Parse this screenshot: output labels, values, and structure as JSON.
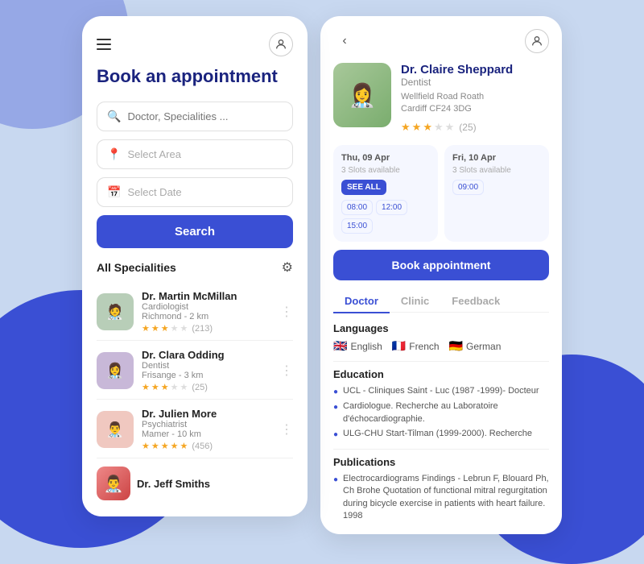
{
  "background": {
    "color": "#c8d8f0"
  },
  "left_panel": {
    "title": "Book an appointment",
    "search_placeholder": "Doctor, Specialities ...",
    "area_placeholder": "Select Area",
    "date_placeholder": "Select Date",
    "search_button": "Search",
    "specialities_title": "All Specialities",
    "doctors": [
      {
        "name": "Dr. Martin McMillan",
        "speciality": "Cardiologist",
        "location": "Richmond - 2 km",
        "stars": 3,
        "total_stars": 5,
        "rating": "(213)",
        "avatar_color": "#b0c4b0",
        "avatar_emoji": "🧑‍⚕️"
      },
      {
        "name": "Dr. Clara Odding",
        "speciality": "Dentist",
        "location": "Frisange - 3 km",
        "stars": 3,
        "total_stars": 5,
        "rating": "(25)",
        "avatar_color": "#c4b8d8",
        "avatar_emoji": "👩‍⚕️"
      },
      {
        "name": "Dr. Julien More",
        "speciality": "Psychiatrist",
        "location": "Mamer - 10 km",
        "stars": 5,
        "total_stars": 5,
        "rating": "(456)",
        "avatar_color": "#f0c8c0",
        "avatar_emoji": "👨‍⚕️"
      },
      {
        "name": "Dr. Jeff Smiths",
        "speciality": "",
        "location": "",
        "stars": 0,
        "total_stars": 5,
        "rating": "",
        "avatar_color": "#b8d4e8",
        "avatar_emoji": "👨‍⚕️"
      }
    ]
  },
  "right_panel": {
    "doctor": {
      "name": "Dr. Claire Sheppard",
      "speciality": "Dentist",
      "address_line1": "Wellfield Road Roath",
      "address_line2": "Cardiff CF24 3DG",
      "stars": 3,
      "total_stars": 5,
      "rating": "(25)"
    },
    "schedule": {
      "day1": {
        "label": "Thu, 09 Apr",
        "slots_label": "3 Slots available",
        "see_all": "SEE ALL",
        "times": [
          "08:00",
          "12:00",
          "15:00"
        ]
      },
      "day2": {
        "label": "Fri, 10 Apr",
        "slots_label": "3 Slots available",
        "times": [
          "09:00"
        ]
      }
    },
    "book_button": "Book appointment",
    "tabs": [
      "Doctor",
      "Clinic",
      "Feedback"
    ],
    "active_tab": "Doctor",
    "languages_section": "Languages",
    "languages": [
      {
        "flag": "🇬🇧",
        "name": "English"
      },
      {
        "flag": "🇫🇷",
        "name": "French"
      },
      {
        "flag": "🇩🇪",
        "name": "German"
      }
    ],
    "education_section": "Education",
    "education": [
      "UCL - Cliniques Saint - Luc (1987 -1999)- Docteur",
      "Cardiologue. Recherche au Laboratoire d'échocardiographie.",
      "ULG-CHU Start-Tilman (1999-2000). Recherche"
    ],
    "publications_section": "Publications",
    "publications": [
      "Electrocardiograms Findings - Lebrun F, Blouard Ph, Ch Brohe Quotation of functional mitral regurgitation during bicycle exercise in patients with heart failure. 1998"
    ]
  }
}
